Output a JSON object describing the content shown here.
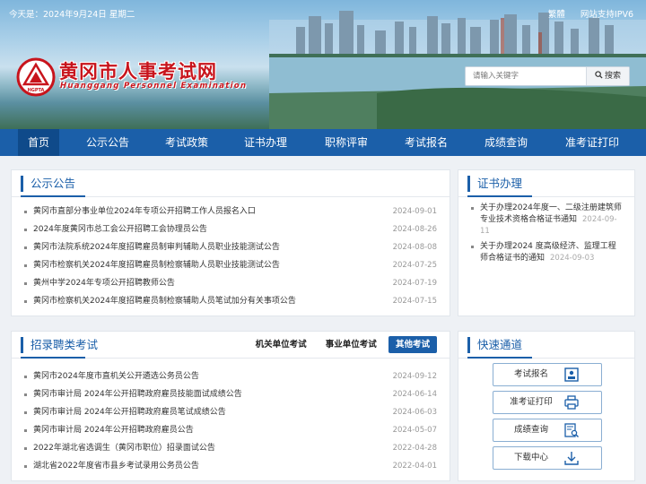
{
  "header": {
    "date_text": "今天是：2024年9月24日 星期二",
    "link_traditional": "繁體",
    "link_ipv6": "网站支持IPV6",
    "site_title": "黄冈市人事考试网",
    "site_subtitle": "Huanggang Personnel Examination",
    "logo_text": "HGPTA"
  },
  "search": {
    "placeholder": "请输入关键字",
    "button_label": "搜索"
  },
  "nav": {
    "items": [
      {
        "label": "首页"
      },
      {
        "label": "公示公告"
      },
      {
        "label": "考试政策"
      },
      {
        "label": "证书办理"
      },
      {
        "label": "职称评审"
      },
      {
        "label": "考试报名"
      },
      {
        "label": "成绩查询"
      },
      {
        "label": "准考证打印"
      }
    ],
    "active_index": 0
  },
  "announcements": {
    "title": "公示公告",
    "items": [
      {
        "text": "黄冈市直部分事业单位2024年专项公开招聘工作人员报名入口",
        "date": "2024-09-01"
      },
      {
        "text": "2024年度黄冈市总工会公开招聘工会协理员公告",
        "date": "2024-08-26"
      },
      {
        "text": "黄冈市法院系统2024年度招聘雇员制审判辅助人员职业技能测试公告",
        "date": "2024-08-08"
      },
      {
        "text": "黄冈市检察机关2024年度招聘雇员制检察辅助人员职业技能测试公告",
        "date": "2024-07-25"
      },
      {
        "text": "黄州中学2024年专项公开招聘教师公告",
        "date": "2024-07-19"
      },
      {
        "text": "黄冈市检察机关2024年度招聘雇员制检察辅助人员笔试加分有关事项公告",
        "date": "2024-07-15"
      }
    ]
  },
  "certificates": {
    "title": "证书办理",
    "items": [
      {
        "text": "关于办理2024年度一、二级注册建筑师专业技术资格合格证书通知",
        "date": "2024-09-11"
      },
      {
        "text": "关于办理2024 度高级经济、监理工程师合格证书的通知",
        "date": "2024-09-03"
      }
    ]
  },
  "recruitment": {
    "title": "招录聘类考试",
    "tabs": [
      {
        "label": "机关单位考试"
      },
      {
        "label": "事业单位考试"
      },
      {
        "label": "其他考试"
      }
    ],
    "active_tab": 2,
    "items": [
      {
        "text": "黄冈市2024年度市直机关公开遴选公务员公告",
        "date": "2024-09-12"
      },
      {
        "text": "黄冈市审计局 2024年公开招聘政府雇员技能面试成绩公告",
        "date": "2024-06-14"
      },
      {
        "text": "黄冈市审计局 2024年公开招聘政府雇员笔试成绩公告",
        "date": "2024-06-03"
      },
      {
        "text": "黄冈市审计局 2024年公开招聘政府雇员公告",
        "date": "2024-05-07"
      },
      {
        "text": "2022年湖北省选调生（黄冈市职位）招录面试公告",
        "date": "2022-04-28"
      },
      {
        "text": "湖北省2022年度省市县乡考试录用公务员公告",
        "date": "2022-04-01"
      }
    ]
  },
  "quick_access": {
    "title": "快速通道",
    "items": [
      {
        "label": "考试报名",
        "icon": "id-card-icon"
      },
      {
        "label": "准考证打印",
        "icon": "printer-icon"
      },
      {
        "label": "成绩查询",
        "icon": "search-document-icon"
      },
      {
        "label": "下载中心",
        "icon": "download-icon"
      }
    ]
  },
  "colors": {
    "primary": "#1b5fa9",
    "nav_active": "#0f4a8a",
    "title_red": "#c8141c"
  }
}
